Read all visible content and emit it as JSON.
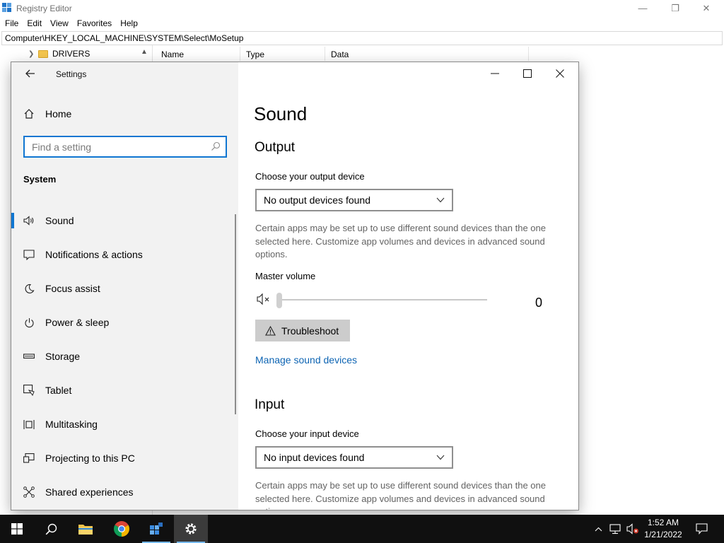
{
  "regedit": {
    "title": "Registry Editor",
    "menu": [
      "File",
      "Edit",
      "View",
      "Favorites",
      "Help"
    ],
    "address": "Computer\\HKEY_LOCAL_MACHINE\\SYSTEM\\Select\\MoSetup",
    "tree_item": "DRIVERS",
    "columns": [
      "Name",
      "Type",
      "Data"
    ]
  },
  "settings": {
    "window_title": "Settings",
    "nav": {
      "home": "Home",
      "search_placeholder": "Find a setting",
      "section": "System",
      "items": [
        {
          "label": "Sound",
          "icon": "speaker-icon",
          "active": true
        },
        {
          "label": "Notifications & actions",
          "icon": "notification-icon"
        },
        {
          "label": "Focus assist",
          "icon": "moon-icon"
        },
        {
          "label": "Power & sleep",
          "icon": "power-icon"
        },
        {
          "label": "Storage",
          "icon": "storage-icon"
        },
        {
          "label": "Tablet",
          "icon": "tablet-icon"
        },
        {
          "label": "Multitasking",
          "icon": "multitasking-icon"
        },
        {
          "label": "Projecting to this PC",
          "icon": "projecting-icon"
        },
        {
          "label": "Shared experiences",
          "icon": "shared-experiences-icon"
        }
      ]
    },
    "content": {
      "title": "Sound",
      "output_heading": "Output",
      "output_label": "Choose your output device",
      "output_value": "No output devices found",
      "output_desc": "Certain apps may be set up to use different sound devices than the one selected here. Customize app volumes and devices in advanced sound options.",
      "master_volume_label": "Master volume",
      "master_volume_value": "0",
      "master_volume_level": 0,
      "troubleshoot": "Troubleshoot",
      "manage_link": "Manage sound devices",
      "input_heading": "Input",
      "input_label": "Choose your input device",
      "input_value": "No input devices found",
      "input_desc": "Certain apps may be set up to use different sound devices than the one selected here. Customize app volumes and devices in advanced sound options."
    }
  },
  "taskbar": {
    "time": "1:52 AM",
    "date": "1/21/2022",
    "apps": [
      "start-icon",
      "search-icon",
      "file-explorer-icon",
      "chrome-icon",
      "registry-editor-icon",
      "settings-gear-icon"
    ]
  },
  "colors": {
    "accent": "#0f76d1",
    "link": "#0d64b3",
    "nav_bg": "#f2f2f2",
    "taskbar_bg": "#101010"
  }
}
